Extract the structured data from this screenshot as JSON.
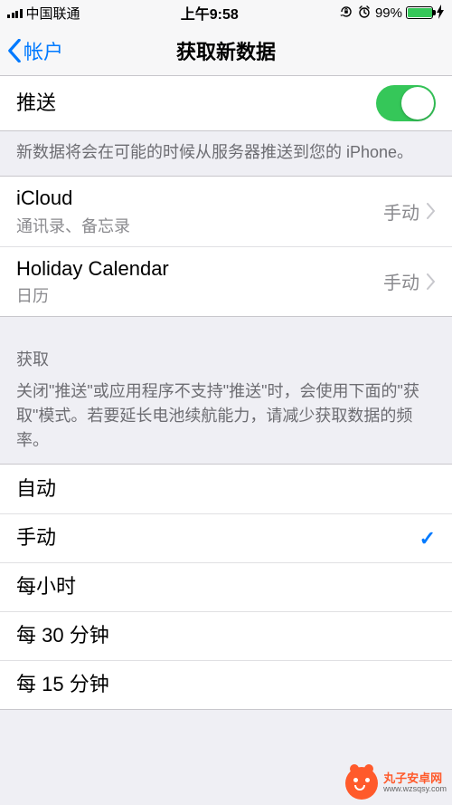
{
  "status": {
    "carrier": "中国联通",
    "time": "上午9:58",
    "battery": "99%"
  },
  "nav": {
    "back": "帐户",
    "title": "获取新数据"
  },
  "push": {
    "label": "推送",
    "on": true,
    "footer": "新数据将会在可能的时候从服务器推送到您的 iPhone。"
  },
  "accounts": [
    {
      "title": "iCloud",
      "subtitle": "通讯录、备忘录",
      "value": "手动"
    },
    {
      "title": "Holiday Calendar",
      "subtitle": "日历",
      "value": "手动"
    }
  ],
  "fetch": {
    "header": "获取",
    "description": "关闭\"推送\"或应用程序不支持\"推送\"时，会使用下面的\"获取\"模式。若要延长电池续航能力，请减少获取数据的频率。",
    "options": [
      "自动",
      "手动",
      "每小时",
      "每 30 分钟",
      "每 15 分钟"
    ],
    "selected": "手动"
  },
  "watermark": {
    "name": "丸子安卓网",
    "url": "www.wzsqsy.com"
  }
}
